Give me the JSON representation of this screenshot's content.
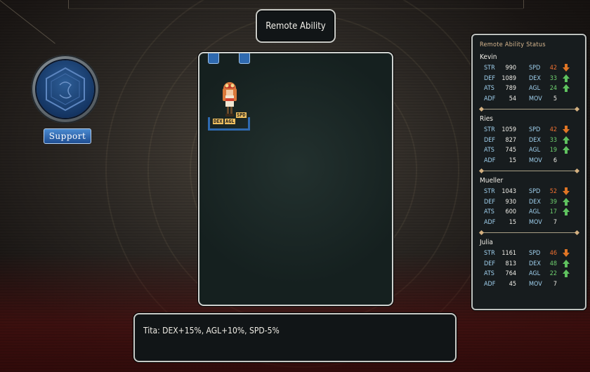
{
  "title": "Remote Ability",
  "support": {
    "label": "Support"
  },
  "board": {
    "unit": {
      "name": "Tita",
      "buffs": [
        "DEX",
        "AGL",
        "SPD"
      ]
    }
  },
  "message": "Tita: DEX+15%, AGL+10%, SPD-5%",
  "status_panel": {
    "title": "Remote Ability Status",
    "members": [
      {
        "name": "Kevin",
        "rows": [
          {
            "l1": "STR",
            "v1": "990",
            "l2": "SPD",
            "v2": "42",
            "trend": "down",
            "color": "#f07030"
          },
          {
            "l1": "DEF",
            "v1": "1089",
            "l2": "DEX",
            "v2": "33",
            "trend": "up",
            "color": "#6fd06f"
          },
          {
            "l1": "ATS",
            "v1": "789",
            "l2": "AGL",
            "v2": "24",
            "trend": "up",
            "color": "#6fd06f"
          },
          {
            "l1": "ADF",
            "v1": "54",
            "l2": "MOV",
            "v2": "5",
            "trend": "",
            "color": "#f0eee8"
          }
        ]
      },
      {
        "name": "Ries",
        "rows": [
          {
            "l1": "STR",
            "v1": "1059",
            "l2": "SPD",
            "v2": "42",
            "trend": "down",
            "color": "#f07030"
          },
          {
            "l1": "DEF",
            "v1": "827",
            "l2": "DEX",
            "v2": "33",
            "trend": "up",
            "color": "#6fd06f"
          },
          {
            "l1": "ATS",
            "v1": "745",
            "l2": "AGL",
            "v2": "19",
            "trend": "up",
            "color": "#6fd06f"
          },
          {
            "l1": "ADF",
            "v1": "15",
            "l2": "MOV",
            "v2": "6",
            "trend": "",
            "color": "#f0eee8"
          }
        ]
      },
      {
        "name": "Mueller",
        "rows": [
          {
            "l1": "STR",
            "v1": "1043",
            "l2": "SPD",
            "v2": "52",
            "trend": "down",
            "color": "#f07030"
          },
          {
            "l1": "DEF",
            "v1": "930",
            "l2": "DEX",
            "v2": "39",
            "trend": "up",
            "color": "#6fd06f"
          },
          {
            "l1": "ATS",
            "v1": "600",
            "l2": "AGL",
            "v2": "17",
            "trend": "up",
            "color": "#6fd06f"
          },
          {
            "l1": "ADF",
            "v1": "15",
            "l2": "MOV",
            "v2": "7",
            "trend": "",
            "color": "#f0eee8"
          }
        ]
      },
      {
        "name": "Julia",
        "rows": [
          {
            "l1": "STR",
            "v1": "1161",
            "l2": "SPD",
            "v2": "46",
            "trend": "down",
            "color": "#f07030"
          },
          {
            "l1": "DEF",
            "v1": "813",
            "l2": "DEX",
            "v2": "48",
            "trend": "up",
            "color": "#6fd06f"
          },
          {
            "l1": "ATS",
            "v1": "764",
            "l2": "AGL",
            "v2": "22",
            "trend": "up",
            "color": "#6fd06f"
          },
          {
            "l1": "ADF",
            "v1": "45",
            "l2": "MOV",
            "v2": "7",
            "trend": "",
            "color": "#f0eee8"
          }
        ]
      }
    ]
  }
}
